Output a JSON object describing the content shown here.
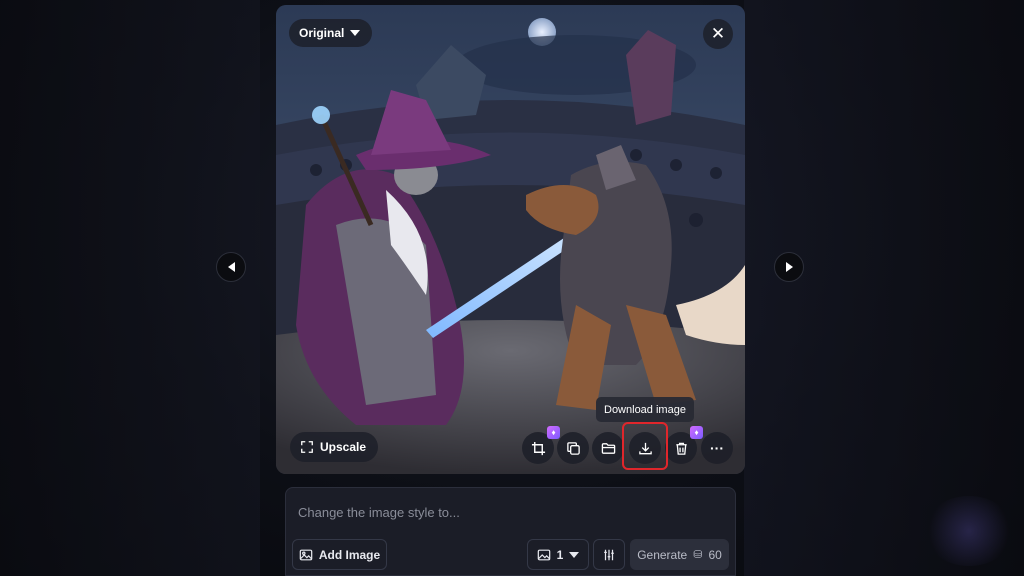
{
  "viewer": {
    "version_label": "Original",
    "close_symbol": "✕"
  },
  "actions": {
    "upscale_label": "Upscale",
    "tooltip": "Download image",
    "more_symbol": "···",
    "premium_symbol": "♦"
  },
  "prompt": {
    "placeholder": "Change the image style to...",
    "value": ""
  },
  "toolbar": {
    "add_image_label": "Add Image",
    "image_count": "1",
    "generate_label": "Generate",
    "credit_cost": "60"
  },
  "colors": {
    "highlight": "#e0262b",
    "premium_badge": "#b763ff"
  },
  "icons": [
    "upscale-icon",
    "crop-premium-icon",
    "copy-icon",
    "folder-icon",
    "download-icon",
    "delete-icon",
    "more-icon",
    "image-icon",
    "sliders-icon",
    "token-icon",
    "close-icon",
    "caret-down-icon",
    "chevron-left-icon",
    "chevron-right-icon"
  ]
}
